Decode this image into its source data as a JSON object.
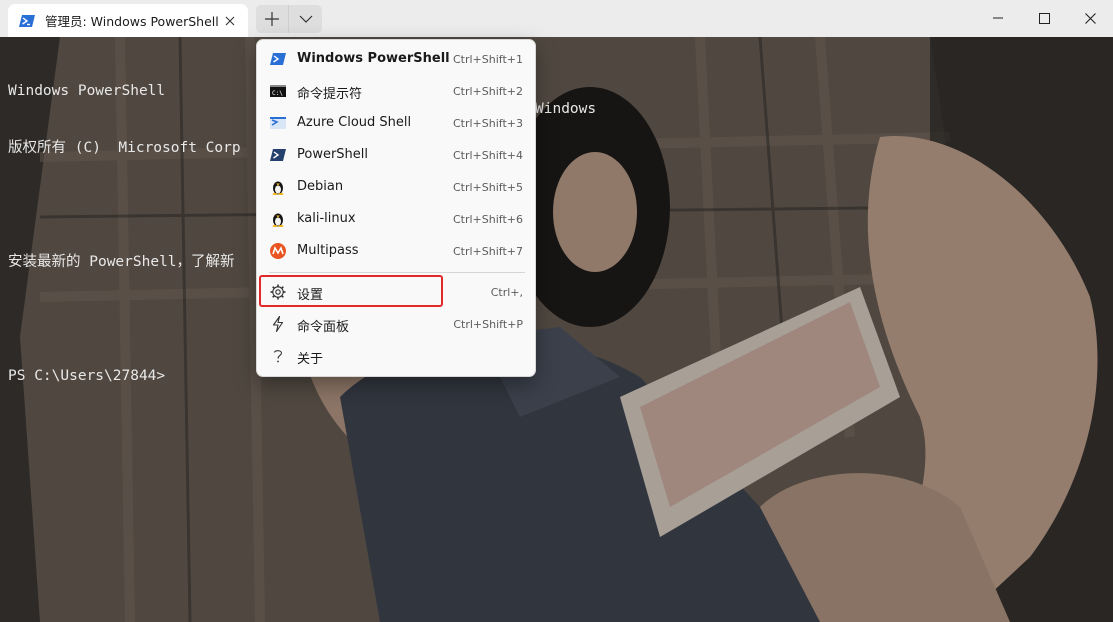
{
  "tab": {
    "title": "管理员: Windows PowerShell"
  },
  "terminal": {
    "lines": [
      "Windows PowerShell",
      "版权所有 (C)  Microsoft Corp",
      "",
      "安装最新的 PowerShell，了解新",
      "",
      "PS C:\\Users\\27844>"
    ],
    "trailing_fragment": "Windows"
  },
  "menu": {
    "items": [
      {
        "label": "Windows PowerShell",
        "shortcut": "Ctrl+Shift+1",
        "icon": "powershell-icon"
      },
      {
        "label": "命令提示符",
        "shortcut": "Ctrl+Shift+2",
        "icon": "cmd-icon"
      },
      {
        "label": "Azure Cloud Shell",
        "shortcut": "Ctrl+Shift+3",
        "icon": "azure-icon"
      },
      {
        "label": "PowerShell",
        "shortcut": "Ctrl+Shift+4",
        "icon": "powershell-icon"
      },
      {
        "label": "Debian",
        "shortcut": "Ctrl+Shift+5",
        "icon": "linux-penguin-icon"
      },
      {
        "label": "kali-linux",
        "shortcut": "Ctrl+Shift+6",
        "icon": "linux-penguin-icon"
      },
      {
        "label": "Multipass",
        "shortcut": "Ctrl+Shift+7",
        "icon": "multipass-icon"
      },
      {
        "label": "设置",
        "shortcut": "Ctrl+,",
        "icon": "gear-icon"
      },
      {
        "label": "命令面板",
        "shortcut": "Ctrl+Shift+P",
        "icon": "lightning-icon"
      },
      {
        "label": "关于",
        "shortcut": "",
        "icon": "question-icon"
      }
    ]
  },
  "colors": {
    "highlight": "#e02a2a",
    "powershell": "#2a6fd6",
    "multipass": "#e95420"
  }
}
